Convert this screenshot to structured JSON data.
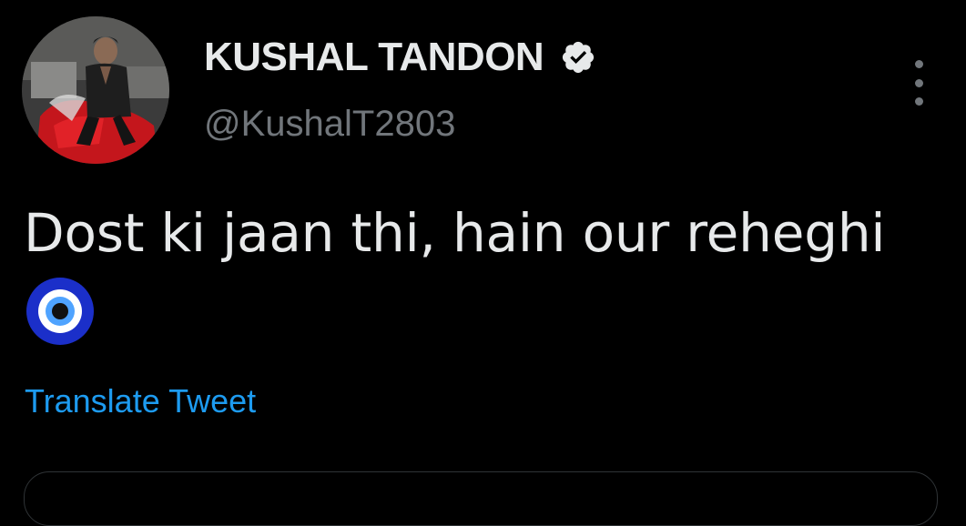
{
  "tweet": {
    "author": {
      "display_name": "KUSHAL TANDON",
      "handle": "@KushalT2803",
      "verified": true,
      "avatar_icon": "profile-photo"
    },
    "text": "Dost ki jaan thi, hain our reheghi",
    "emoji": "nazar-amulet",
    "translate_label": "Translate Tweet",
    "menu_icon": "more-vertical-icon"
  },
  "colors": {
    "background": "#000000",
    "primary_text": "#e7e9ea",
    "secondary_text": "#71767b",
    "link": "#1d9bf0",
    "border": "#2f3336"
  }
}
